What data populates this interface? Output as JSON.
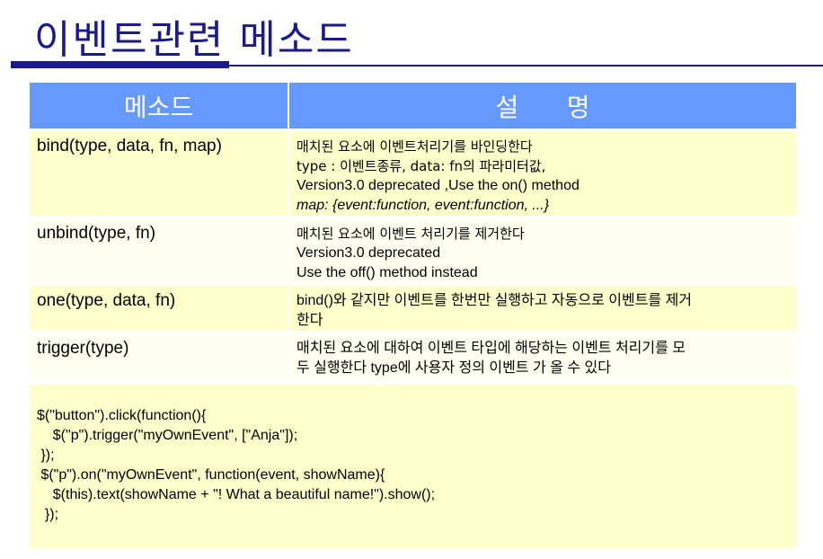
{
  "title": "이벤트관련 메소드",
  "table": {
    "headers": [
      "메소드",
      "설      명"
    ],
    "rows": [
      {
        "method": "bind(type, data, fn, map)",
        "lines": [
          "매치된 요소에 이벤트처리기를 바인딩한다",
          "type : 이벤트종류, data: fn의 파라미터값,",
          "Version3.0 deprecated ,Use the on() method",
          "map: {event:function, event:function, ...}"
        ]
      },
      {
        "method": "unbind(type, fn)",
        "lines": [
          "매치된 요소에 이벤트 처리기를 제거한다",
          "Version3.0 deprecated",
          "Use the off() method instead"
        ]
      },
      {
        "method": "one(type, data, fn)",
        "lines": [
          "bind()와 같지만 이벤트를 한번만 실행하고 자동으로 이벤트를 제거",
          "한다"
        ]
      },
      {
        "method": "trigger(type)",
        "lines": [
          "매치된 요소에 대하여 이벤트 타입에 해당하는 이벤트 처리기를 모",
          "두 실행한다  type에 사용자 정의 이벤트 가 올 수 있다"
        ]
      }
    ]
  },
  "code": [
    "$(\"button\").click(function(){",
    "    $(\"p\").trigger(\"myOwnEvent\", [\"Anja\"]);",
    " });",
    " $(\"p\").on(\"myOwnEvent\", function(event, showName){",
    "    $(this).text(showName + \"! What a beautiful name!\").show();",
    "  });"
  ]
}
